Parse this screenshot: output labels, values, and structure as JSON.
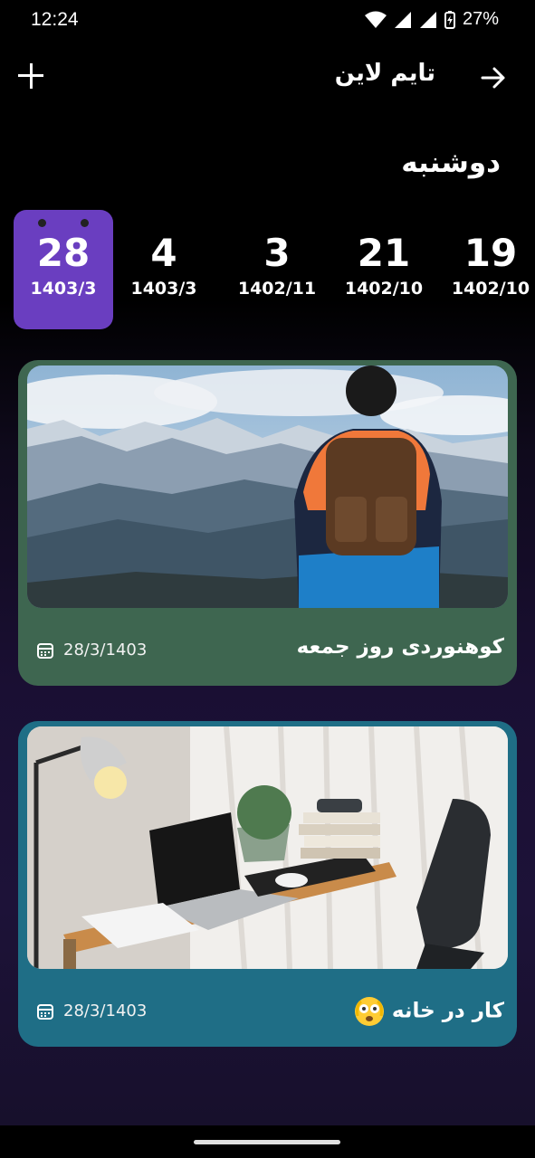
{
  "status_bar": {
    "time": "12:24",
    "battery": "27%"
  },
  "header": {
    "title": "تایم لاین",
    "add_icon": "plus-icon",
    "back_icon": "arrow-right-icon"
  },
  "day_name": "دوشنبه",
  "date_strip": [
    {
      "day": "28",
      "date": "1403/3",
      "selected": true
    },
    {
      "day": "4",
      "date": "1403/3",
      "selected": false
    },
    {
      "day": "3",
      "date": "1402/11",
      "selected": false
    },
    {
      "day": "21",
      "date": "1402/10",
      "selected": false
    },
    {
      "day": "19",
      "date": "1402/10",
      "selected": false
    }
  ],
  "timeline": [
    {
      "title": "کوهنوردی روز جمعه",
      "date": "28/3/1403",
      "color": "#3e6650",
      "image": "hiker-mountains"
    },
    {
      "title": "کار در خانه",
      "emoji": "flushed-face-emoji",
      "date": "28/3/1403",
      "color": "#1f6e86",
      "image": "home-desk"
    }
  ],
  "colors": {
    "selected_chip": "#6a3ec0",
    "background_end": "#1d1238"
  }
}
